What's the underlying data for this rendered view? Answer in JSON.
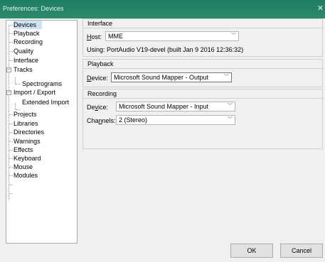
{
  "window": {
    "title": "Preferences: Devices"
  },
  "tree": {
    "items": [
      {
        "label": "Devices"
      },
      {
        "label": "Playback"
      },
      {
        "label": "Recording"
      },
      {
        "label": "Quality"
      },
      {
        "label": "Interface"
      },
      {
        "label": "Tracks"
      },
      {
        "label": "Spectrograms"
      },
      {
        "label": "Import / Export"
      },
      {
        "label": "Extended Import"
      },
      {
        "label": "Projects"
      },
      {
        "label": "Libraries"
      },
      {
        "label": "Directories"
      },
      {
        "label": "Warnings"
      },
      {
        "label": "Effects"
      },
      {
        "label": "Keyboard"
      },
      {
        "label": "Mouse"
      },
      {
        "label": "Modules"
      }
    ],
    "selected": "Devices"
  },
  "interface": {
    "title": "Interface",
    "host_label_first": "H",
    "host_label_rest": "ost:",
    "host_value": "MME",
    "using_text": "Using: PortAudio V19-devel (built Jan  9 2016 12:36:32)"
  },
  "playback": {
    "title": "Playback",
    "device_label_first": "D",
    "device_label_rest": "evice:",
    "device_value": "Microsoft Sound Mapper - Output"
  },
  "recording": {
    "title": "Recording",
    "device_label_pre": "De",
    "device_label_u": "v",
    "device_label_post": "ice:",
    "device_value": "Microsoft Sound Mapper - Input",
    "channels_label_pre": "Cha",
    "channels_label_u": "n",
    "channels_label_post": "nels:",
    "channels_value": "2 (Stereo)"
  },
  "buttons": {
    "ok": "OK",
    "cancel": "Cancel"
  },
  "icons": {
    "close": "close-icon",
    "dropdown": "chevron-down-icon"
  },
  "colors": {
    "titlebar": "#1f7d61",
    "selection": "#cde2f5"
  }
}
